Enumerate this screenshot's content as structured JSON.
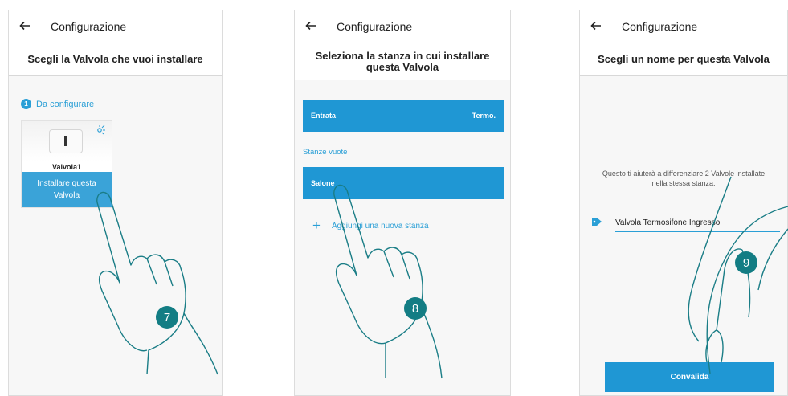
{
  "screens": [
    {
      "title": "Configurazione",
      "heading": "Scegli la Valvola che vuoi installare",
      "section": {
        "number": "1",
        "label": "Da configurare"
      },
      "device": {
        "name": "Valvola1",
        "action": "Installare questa Valvola"
      },
      "step": "7"
    },
    {
      "title": "Configurazione",
      "heading": "Seleziona la stanza in cui installare questa Valvola",
      "rooms": [
        {
          "name": "Entrata",
          "tag": "Termo."
        }
      ],
      "empty_label": "Stanze vuote",
      "empty_rooms": [
        {
          "name": "Salone"
        }
      ],
      "add_room": "Aggiungi una nuova stanza",
      "step": "8"
    },
    {
      "title": "Configurazione",
      "heading": "Scegli un nome per questa Valvola",
      "hint": "Questo ti aiuterà a differenziare 2 Valvole installate nella stessa stanza.",
      "name_value": "Valvola Termosifone Ingresso",
      "confirm": "Convalida",
      "step": "9"
    }
  ],
  "icons": [
    "back-arrow-icon",
    "signal-icon",
    "plus-icon",
    "tag-icon"
  ],
  "colors": {
    "accent": "#2a9fd6",
    "button": "#1f97d4",
    "step_badge": "#137d84",
    "hand_outline": "#1a7d86"
  }
}
